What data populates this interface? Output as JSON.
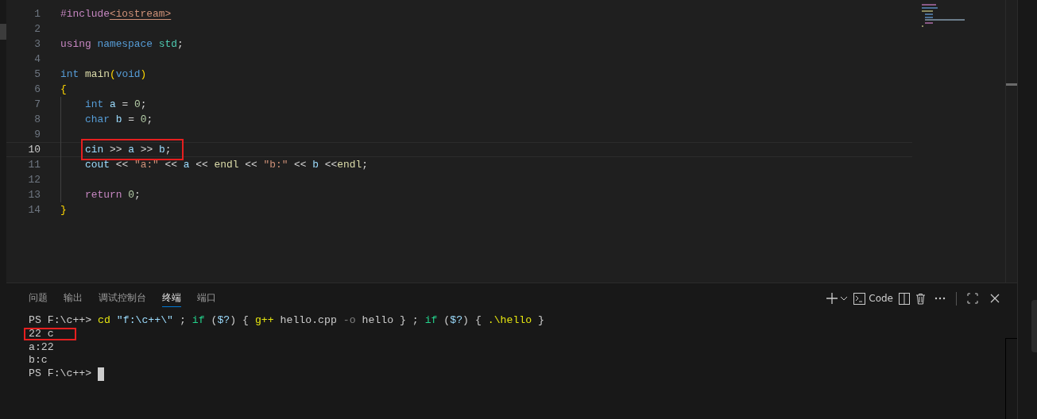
{
  "editor": {
    "lines": [
      {
        "number": "1",
        "current": false,
        "annotated": false,
        "indented": false,
        "tokens": [
          {
            "text": "#include",
            "kind": "directive"
          },
          {
            "text": "<iostream>",
            "kind": "header"
          }
        ]
      },
      {
        "number": "2",
        "current": false,
        "annotated": false,
        "indented": false
      },
      {
        "number": "3",
        "current": false,
        "annotated": false,
        "indented": false,
        "tokens": [
          {
            "text": "using",
            "kind": "control"
          },
          {
            "text": " namespace",
            "kind": "keyword"
          },
          {
            "text": " std",
            "kind": "type"
          },
          {
            "text": ";",
            "kind": "plain"
          }
        ]
      },
      {
        "number": "4",
        "current": false,
        "annotated": false,
        "indented": false
      },
      {
        "number": "5",
        "current": false,
        "annotated": false,
        "indented": false,
        "tokens": [
          {
            "text": "int",
            "kind": "keyword"
          },
          {
            "text": " main",
            "kind": "function"
          },
          {
            "text": "(",
            "kind": "bracket"
          },
          {
            "text": "void",
            "kind": "keyword"
          },
          {
            "text": ")",
            "kind": "bracket"
          }
        ]
      },
      {
        "number": "6",
        "current": false,
        "annotated": false,
        "indented": false,
        "tokens": [
          {
            "text": "{",
            "kind": "bracket"
          }
        ]
      },
      {
        "number": "7",
        "current": false,
        "annotated": false,
        "indented": true,
        "tokens": [
          {
            "text": "int",
            "kind": "keyword"
          },
          {
            "text": " a",
            "kind": "variable"
          },
          {
            "text": " = ",
            "kind": "plain"
          },
          {
            "text": "0",
            "kind": "number"
          },
          {
            "text": ";",
            "kind": "plain"
          }
        ]
      },
      {
        "number": "8",
        "current": false,
        "annotated": false,
        "indented": true,
        "tokens": [
          {
            "text": "char",
            "kind": "keyword"
          },
          {
            "text": " b",
            "kind": "variable"
          },
          {
            "text": " = ",
            "kind": "plain"
          },
          {
            "text": "0",
            "kind": "number"
          },
          {
            "text": ";",
            "kind": "plain"
          }
        ]
      },
      {
        "number": "9",
        "current": false,
        "annotated": false,
        "indented": true
      },
      {
        "number": "10",
        "current": true,
        "annotated": true,
        "indented": true,
        "tokens": [
          {
            "text": "cin",
            "kind": "variable"
          },
          {
            "text": " >> ",
            "kind": "plain"
          },
          {
            "text": "a",
            "kind": "variable"
          },
          {
            "text": " >> ",
            "kind": "plain"
          },
          {
            "text": "b",
            "kind": "variable"
          },
          {
            "text": ";",
            "kind": "plain"
          }
        ]
      },
      {
        "number": "11",
        "current": false,
        "annotated": false,
        "indented": true,
        "tokens": [
          {
            "text": "cout",
            "kind": "variable"
          },
          {
            "text": " << ",
            "kind": "plain"
          },
          {
            "text": "\"a:\"",
            "kind": "string"
          },
          {
            "text": " << ",
            "kind": "plain"
          },
          {
            "text": "a",
            "kind": "variable"
          },
          {
            "text": " << ",
            "kind": "plain"
          },
          {
            "text": "endl",
            "kind": "function"
          },
          {
            "text": " << ",
            "kind": "plain"
          },
          {
            "text": "\"b:\"",
            "kind": "string"
          },
          {
            "text": " << ",
            "kind": "plain"
          },
          {
            "text": "b",
            "kind": "variable"
          },
          {
            "text": " <<",
            "kind": "plain"
          },
          {
            "text": "endl",
            "kind": "function"
          },
          {
            "text": ";",
            "kind": "plain"
          }
        ]
      },
      {
        "number": "12",
        "current": false,
        "annotated": false,
        "indented": true
      },
      {
        "number": "13",
        "current": false,
        "annotated": false,
        "indented": true,
        "tokens": [
          {
            "text": "return",
            "kind": "control"
          },
          {
            "text": " 0",
            "kind": "number"
          },
          {
            "text": ";",
            "kind": "plain"
          }
        ]
      },
      {
        "number": "14",
        "current": false,
        "annotated": false,
        "indented": false,
        "tokens": [
          {
            "text": "}",
            "kind": "bracket"
          }
        ]
      }
    ]
  },
  "panel": {
    "tabs": [
      {
        "label": "问题",
        "selected": false
      },
      {
        "label": "输出",
        "selected": false
      },
      {
        "label": "调试控制台",
        "selected": false
      },
      {
        "label": "终端",
        "selected": true
      },
      {
        "label": "端口",
        "selected": false
      }
    ],
    "terminal_name": "Code",
    "terminal_lines": [
      {
        "annotated": false,
        "cursor": false,
        "tokens": [
          {
            "text": "PS F:\\c++> ",
            "kind": "plain"
          },
          {
            "text": "cd",
            "kind": "command"
          },
          {
            "text": " \"f:\\c++\\\"",
            "kind": "string"
          },
          {
            "text": " ; ",
            "kind": "plain"
          },
          {
            "text": "if",
            "kind": "keyword"
          },
          {
            "text": " (",
            "kind": "plain"
          },
          {
            "text": "$?",
            "kind": "string"
          },
          {
            "text": ") { ",
            "kind": "plain"
          },
          {
            "text": "g++",
            "kind": "command"
          },
          {
            "text": " hello.cpp ",
            "kind": "plain"
          },
          {
            "text": "-o",
            "kind": "param"
          },
          {
            "text": " hello } ; ",
            "kind": "plain"
          },
          {
            "text": "if",
            "kind": "keyword"
          },
          {
            "text": " (",
            "kind": "plain"
          },
          {
            "text": "$?",
            "kind": "string"
          },
          {
            "text": ") { ",
            "kind": "plain"
          },
          {
            "text": ".\\hello",
            "kind": "command"
          },
          {
            "text": " }",
            "kind": "plain"
          }
        ]
      },
      {
        "annotated": true,
        "cursor": false,
        "tokens": [
          {
            "text": "22 c",
            "kind": "plain"
          }
        ]
      },
      {
        "annotated": false,
        "cursor": false,
        "tokens": [
          {
            "text": "a:22",
            "kind": "plain"
          }
        ]
      },
      {
        "annotated": false,
        "cursor": false,
        "tokens": [
          {
            "text": "b:c",
            "kind": "plain"
          }
        ]
      },
      {
        "annotated": false,
        "cursor": true,
        "tokens": [
          {
            "text": "PS F:\\c++> ",
            "kind": "plain"
          }
        ]
      }
    ]
  }
}
